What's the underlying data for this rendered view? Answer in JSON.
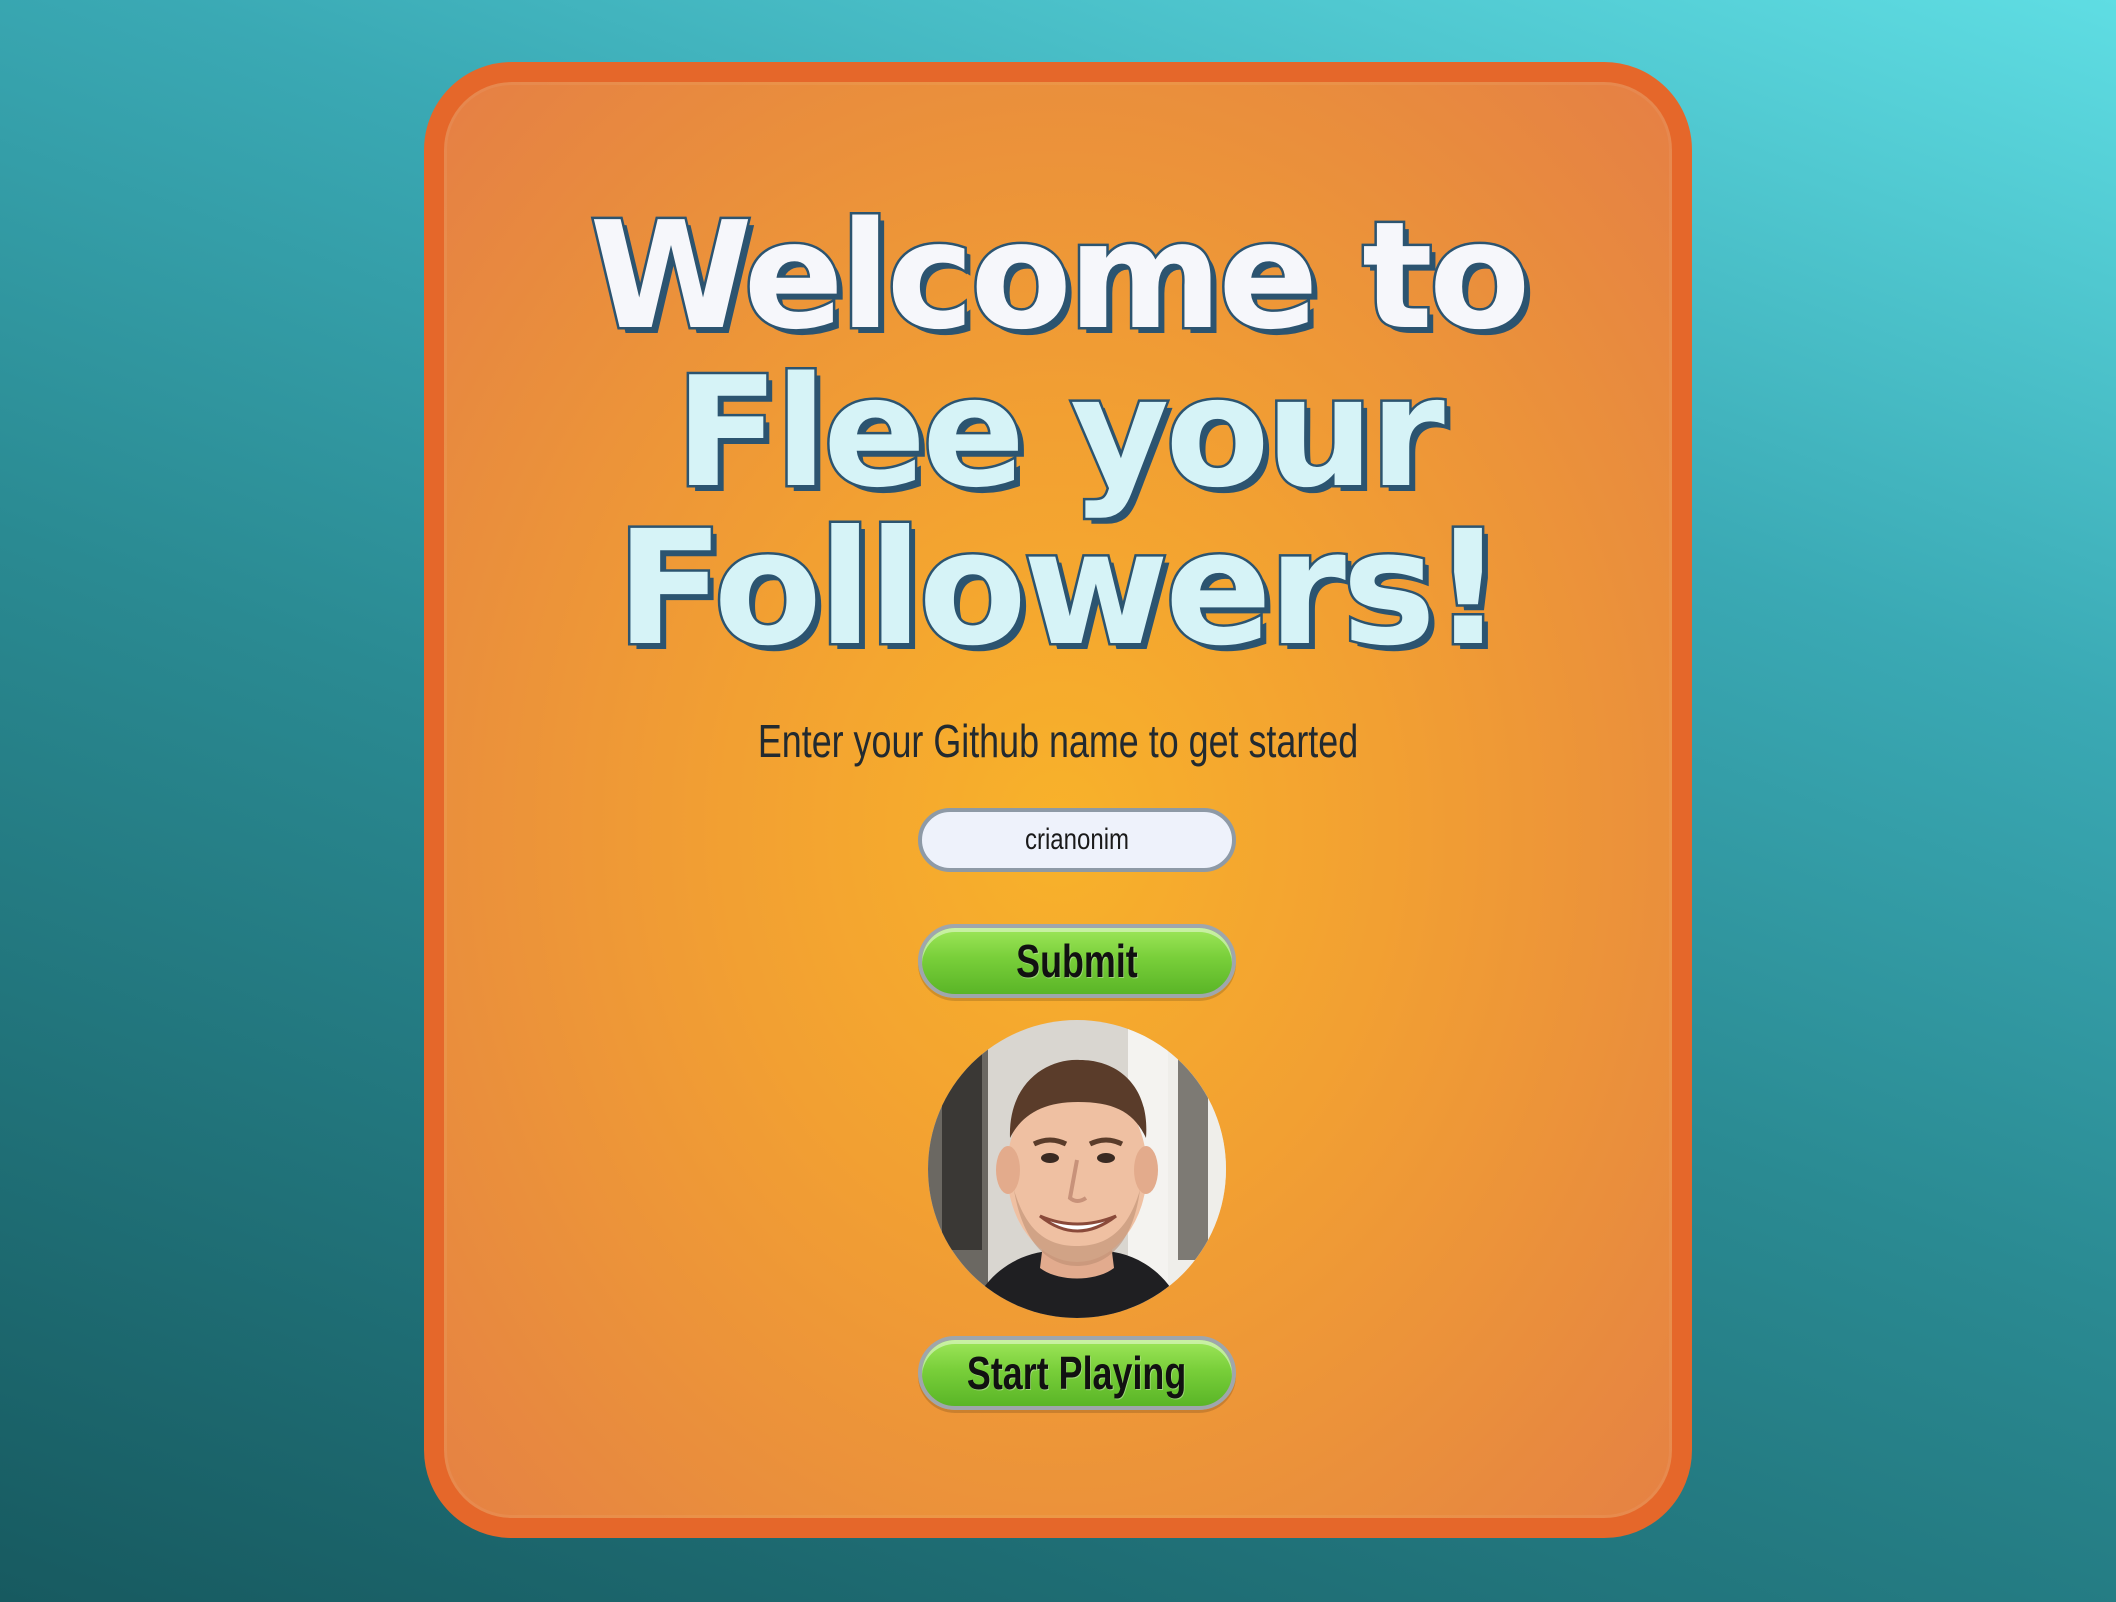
{
  "title": {
    "line1": "Welcome to",
    "line2": "Flee your",
    "line3": "Followers!"
  },
  "prompt": "Enter your Github name to get started",
  "username_input": {
    "value": "crianonim"
  },
  "submit_button": {
    "label": "Submit"
  },
  "start_button": {
    "label": "Start Playing"
  },
  "avatar": {
    "icon": "github-avatar-photo"
  },
  "colors": {
    "card_border": "#e5672a",
    "card_fill": "#f2a032",
    "title_fill": "#d6f3f7",
    "title_outline": "#2c5470",
    "button_green": "#79cf3a"
  }
}
